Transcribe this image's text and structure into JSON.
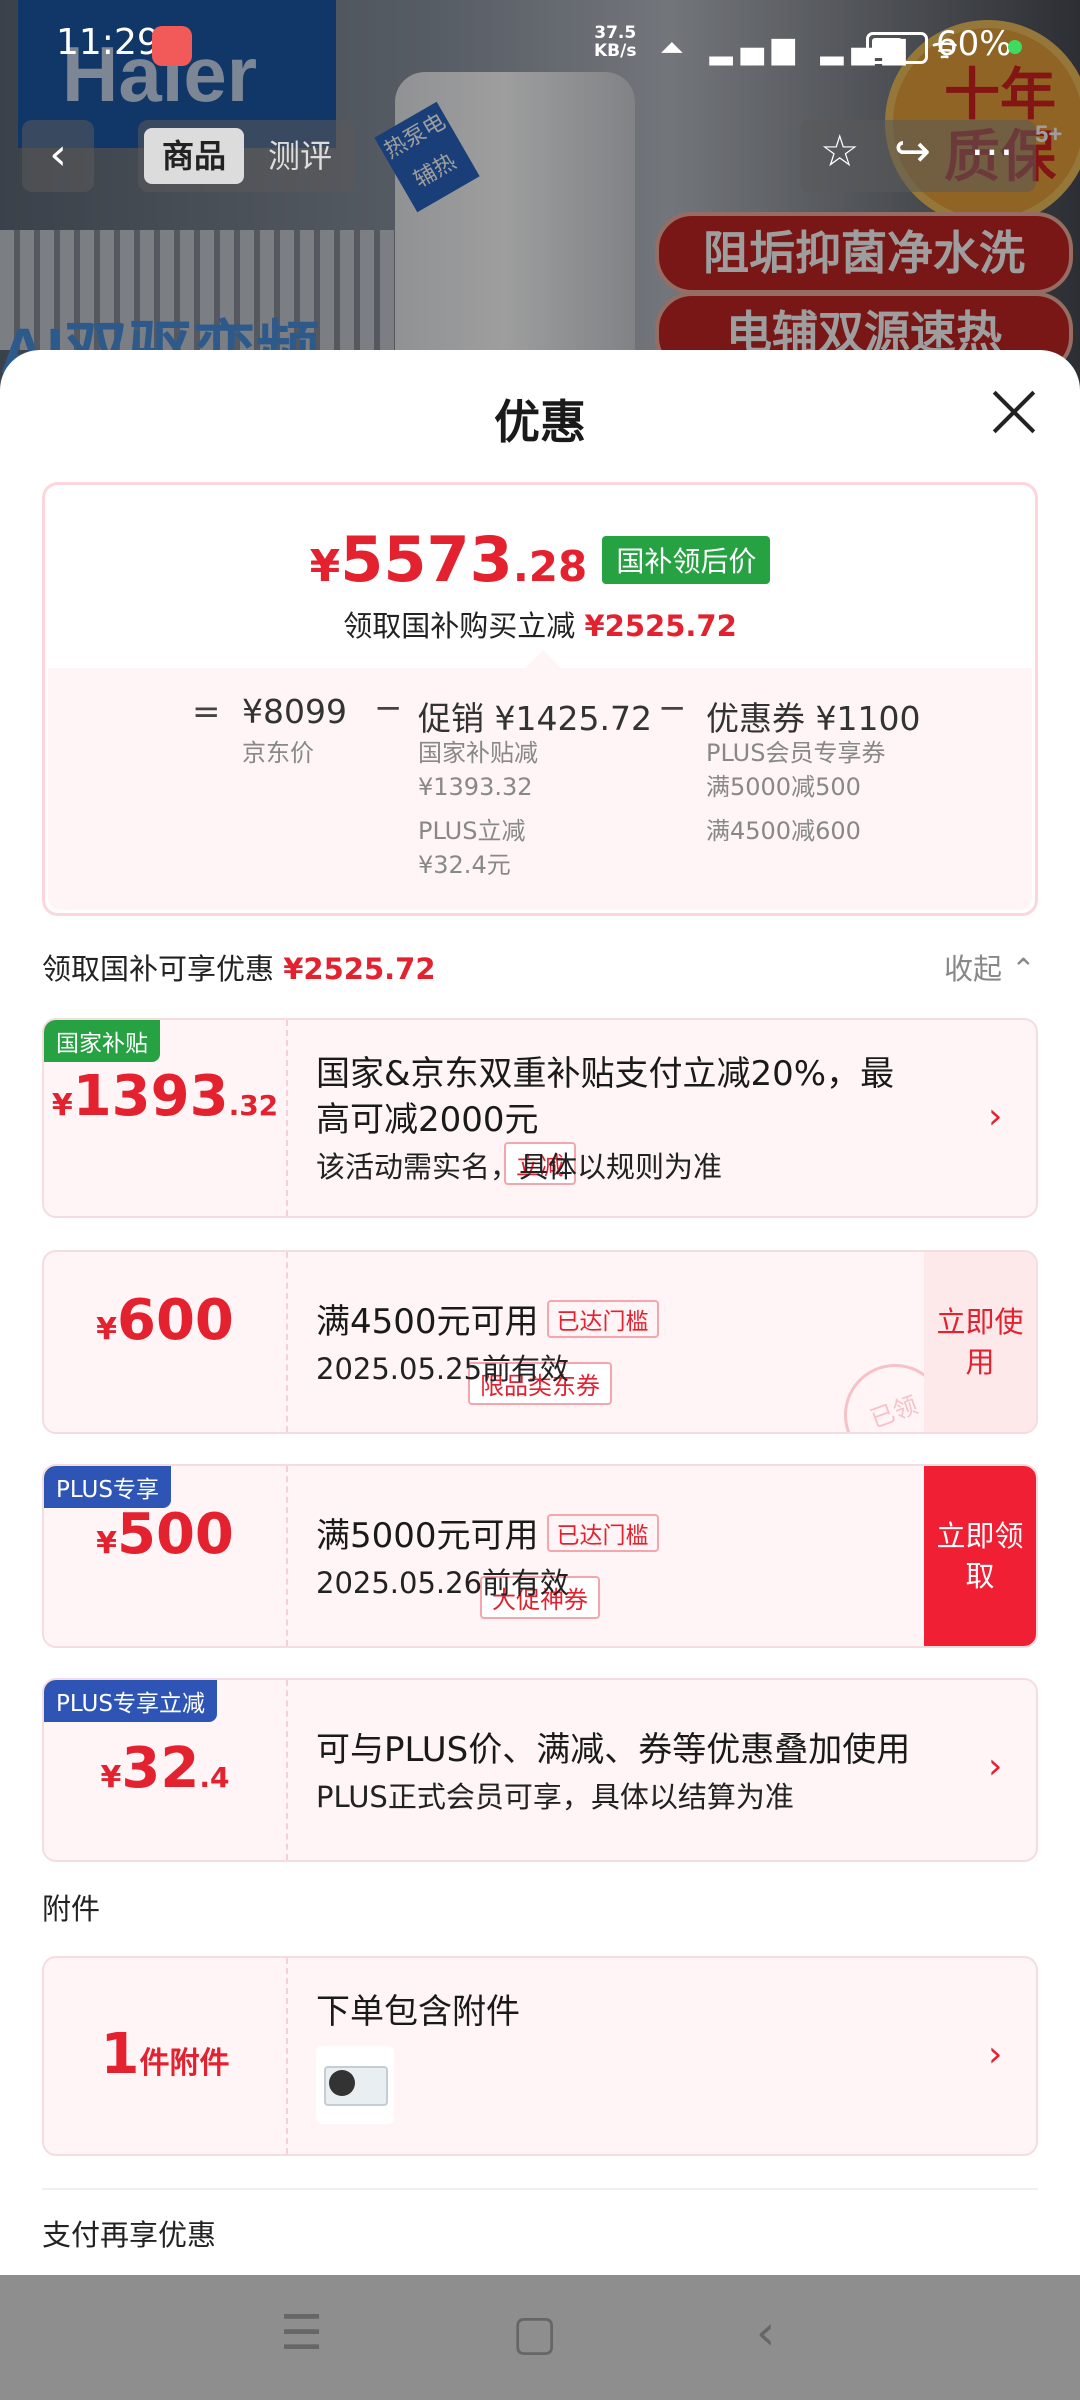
{
  "status_bar": {
    "time": "11:29",
    "net_speed_value": "37.5",
    "net_speed_unit": "KB/s",
    "signal_icons": "⏶ ▂▄▆ ▂▄▆ ᯤ",
    "battery": "60%"
  },
  "background": {
    "logo": "Haier",
    "ai_text": "AI双驱变频",
    "product_tag": "热泵电辅热",
    "seal_text": "十年质保",
    "seal_count": "5+",
    "banners": [
      "阻垢抑菌净水洗",
      "电辅双源速热"
    ]
  },
  "top_nav": {
    "back": "‹",
    "tabs": [
      "商品",
      "测评"
    ],
    "star": "☆",
    "share": "↪",
    "more": "⋯"
  },
  "sheet": {
    "title": "优惠",
    "summary": {
      "currency": "¥",
      "price_int": "5573",
      "price_dec": ".28",
      "price_tag": "国补领后价",
      "sub_label": "领取国补购买立减",
      "sub_amount": "¥2525.72",
      "breakdown": {
        "eq": "=",
        "jd_price": "¥8099",
        "jd_price_label": "京东价",
        "minus1": "−",
        "promo": "促销 ¥1425.72",
        "promo_item1": "国家补贴减",
        "promo_item1_val": "¥1393.32",
        "promo_item2": "PLUS立减",
        "promo_item2_val": "¥32.4元",
        "minus2": "−",
        "coupon": "优惠券 ¥1100",
        "coupon_item1": "PLUS会员专享券",
        "coupon_item1_val": "满5000减500",
        "coupon_item2": "满4500减600"
      }
    },
    "section_label": "领取国补可享优惠",
    "section_amount": "¥2525.72",
    "collapse": "收起 ⌃",
    "cards": [
      {
        "badge": "国家补贴",
        "cur": "¥",
        "int": "1393",
        "dec": ".32",
        "chip": "立减",
        "title": "国家&京东双重补贴支付立减20%，最",
        "title2": "高可减2000元",
        "desc": "该活动需实名，具体以规则为准",
        "chev": "›"
      },
      {
        "cur": "¥",
        "int": "600",
        "chip": "限品类东券",
        "title": "满4500元可用",
        "tag": "已达门槛",
        "desc": "2025.05.25前有效",
        "action": "立即使用",
        "stamp": "已领"
      },
      {
        "badge": "PLUS专享",
        "cur": "¥",
        "int": "500",
        "chip": "大促神券",
        "title": "满5000元可用",
        "tag": "已达门槛",
        "desc": "2025.05.26前有效",
        "action": "立即领取"
      },
      {
        "badge": "PLUS专享立减",
        "cur": "¥",
        "int": "32",
        "dec": ".4",
        "title": "可与PLUS价、满减、券等优惠叠加使用",
        "desc": "PLUS正式会员可享，具体以结算为准",
        "chev": "›"
      }
    ],
    "accessory_section": "附件",
    "accessory": {
      "count": "1",
      "unit": "件附件",
      "title": "下单包含附件",
      "chev": "›"
    },
    "pay_section": "支付再享优惠"
  },
  "system_nav": {
    "menu": "☰",
    "home": "▢",
    "back": "‹"
  },
  "colors": {
    "accent": "#e4212f",
    "green": "#27a243",
    "plus_blue": "#2e54b5"
  }
}
